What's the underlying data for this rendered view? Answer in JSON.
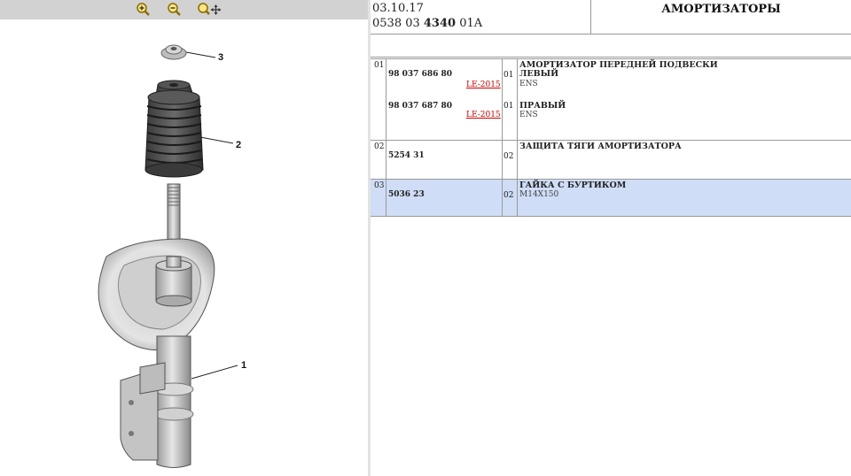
{
  "toolbar": {
    "zoom_in_icon": "zoom-in-icon",
    "zoom_out_icon": "zoom-out-icon",
    "pan_icon": "zoom-pan-icon"
  },
  "diagram": {
    "callouts": [
      "1",
      "2",
      "3"
    ]
  },
  "header": {
    "date": "03.10.17",
    "code_prefix": "0538 03 ",
    "code_bold": "4340",
    "code_suffix": " 01A",
    "title": "АМОРТИЗАТОРЫ"
  },
  "rows": [
    {
      "ref": "01",
      "parts": [
        {
          "number": "98 037 686 80",
          "note": "LE-2015",
          "qty": "01",
          "desc1": "АМОРТИЗАТОР ПЕРЕДНЕЙ ПОДВЕСКИ",
          "desc2": "ЛЕВЫЙ",
          "sub": "ENS"
        },
        {
          "number": "98 037 687 80",
          "note": "LE-2015",
          "qty": "01",
          "desc1": "ПРАВЫЙ",
          "sub": "ENS"
        }
      ]
    },
    {
      "ref": "02",
      "number": "5254 31",
      "qty": "02",
      "desc1": "ЗАЩИТА ТЯГИ АМОРТИЗАТОРА"
    },
    {
      "ref": "03",
      "number": "5036 23",
      "qty": "02",
      "desc1": "ГАЙКА С БУРТИКОМ",
      "sub": "M14X150"
    }
  ],
  "colors": {
    "selected_row": "#cfddf6",
    "toolbar": "#d2d2d2",
    "note_link": "#cc0000"
  }
}
